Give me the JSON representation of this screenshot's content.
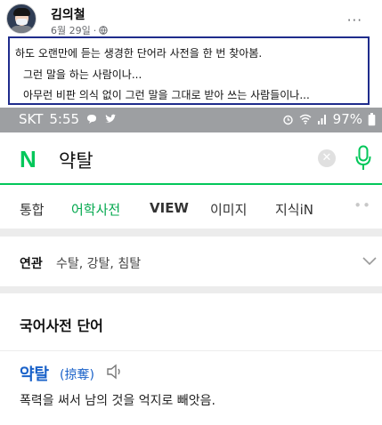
{
  "post": {
    "author": "김의철",
    "date": "6월 29일",
    "separator": "·",
    "more_label": "···",
    "caption_lines": [
      "하도 오랜만에 듣는 생경한 단어라 사전을 한 번 찾아봄.",
      "그런 말을 하는 사람이나...",
      "아무런 비판 의식 없이 그런 말을 그대로 받아 쓰는 사람들이나..."
    ]
  },
  "screenshot": {
    "status": {
      "carrier": "SKT",
      "time": "5:55",
      "battery": "97%"
    },
    "search": {
      "logo": "N",
      "query": "약탈",
      "clear_glyph": "✕"
    },
    "tabs": [
      "통합",
      "어학사전",
      "VIEW",
      "이미지",
      "지식iN"
    ],
    "tabs_more": "••",
    "related": {
      "label": "연관",
      "items": "수탈, 강탈, 침탈"
    },
    "dictionary": {
      "heading": "국어사전 단어",
      "word": "약탈",
      "hanja": "(掠奪)",
      "definition": "폭력을 써서 남의 것을 억지로 빼앗음."
    },
    "colors": {
      "naver_green": "#03c75a",
      "link_blue": "#1a62c9",
      "highlight_border": "#1f2c8c"
    }
  }
}
